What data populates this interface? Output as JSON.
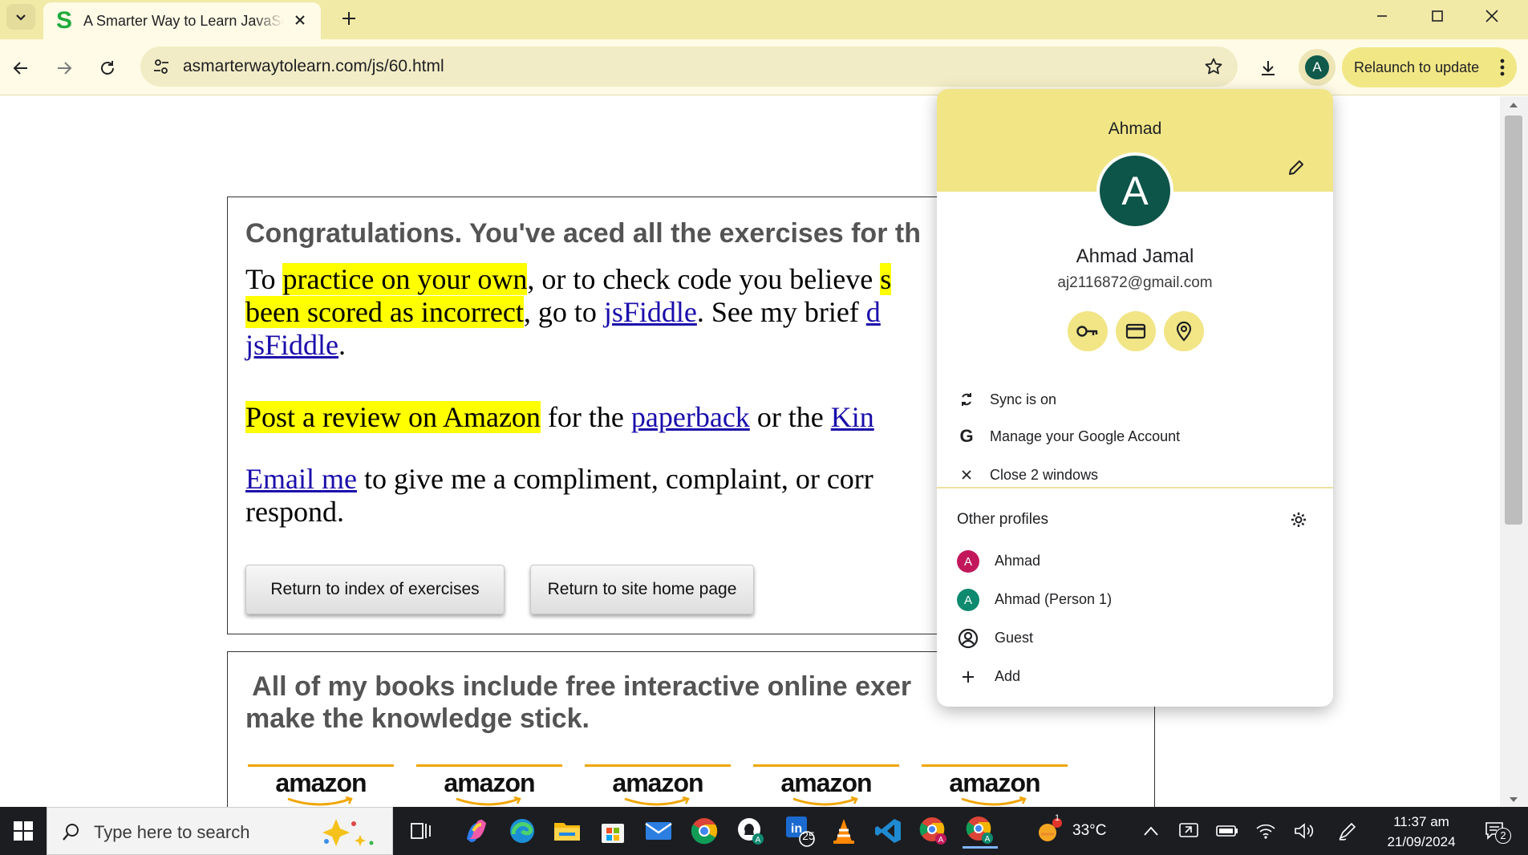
{
  "browser": {
    "tab": {
      "title": "A Smarter Way to Learn JavaScript",
      "favicon_letter": "S",
      "favicon_color": "#1faa3b"
    },
    "url": "asmarterwaytolearn.com/js/60.html",
    "avatar_letter": "A",
    "relaunch_label": "Relaunch to update"
  },
  "page": {
    "heading": "Congratulations. You've aced all the exercises for th",
    "p1": {
      "t1": "To ",
      "h1": "practice on your own",
      "t2": ", or to check code you believe ",
      "h2": "s",
      "h3": "been scored as incorrect",
      "t3": ", go to ",
      "l1": "jsFiddle",
      "t4": ". See my brief ",
      "l2": "d",
      "l3": "jsFiddle",
      "t5": "."
    },
    "p2": {
      "h1": "Post a review on Amazon",
      "t1": " for the ",
      "l1": "paperback",
      "t2": " or the ",
      "l2": "Kin"
    },
    "p3": {
      "l1": "Email me",
      "t1": " to give me a compliment, complaint, or corr",
      "t2": "respond."
    },
    "btn_index": "Return to index of exercises",
    "btn_home": "Return to site home page",
    "books_heading_1": " All of my books include free interactive online exer",
    "books_heading_2": "make the knowledge stick.",
    "amazon_logos": [
      "amazon",
      "amazon",
      "amazon",
      "amazon",
      "amazon"
    ]
  },
  "profile_menu": {
    "profile_label": "Ahmad",
    "avatar_letter": "A",
    "full_name": "Ahmad Jamal",
    "email": "aj2116872@gmail.com",
    "sync": "Sync is on",
    "manage": "Manage your Google Account",
    "close_windows": "Close 2 windows",
    "other_profiles": "Other profiles",
    "profiles": [
      {
        "letter": "A",
        "name": "Ahmad",
        "color": "#c2185b"
      },
      {
        "letter": "A",
        "name": "Ahmad (Person 1)",
        "color": "#0e8a6f"
      }
    ],
    "guest": "Guest",
    "add": "Add"
  },
  "taskbar": {
    "search_placeholder": "Type here to search",
    "linkedin_badge": "25",
    "weather_badge": "1",
    "temperature": "33°C",
    "time": "11:37 am",
    "date": "21/09/2024",
    "notification_count": "2"
  }
}
